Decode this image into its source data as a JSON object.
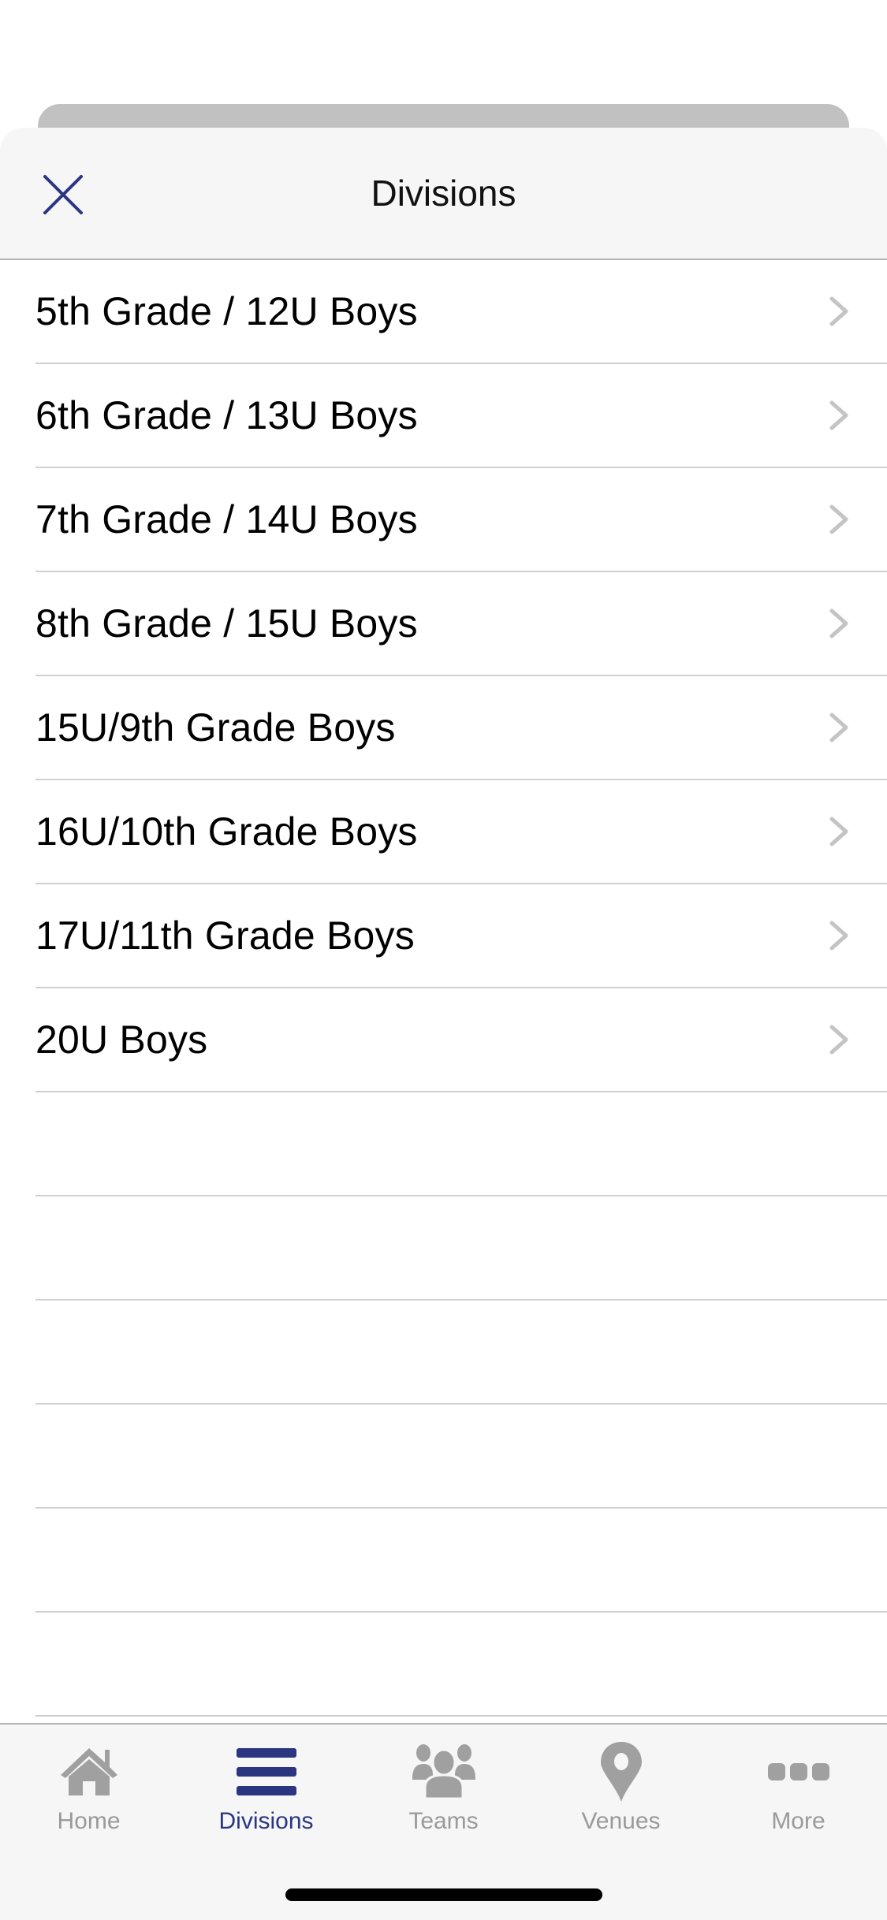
{
  "sheet": {
    "title": "Divisions",
    "close_icon": "close-icon"
  },
  "divisions": [
    {
      "label": "5th Grade / 12U Boys"
    },
    {
      "label": "6th Grade / 13U Boys"
    },
    {
      "label": "7th Grade / 14U Boys"
    },
    {
      "label": "8th Grade / 15U Boys"
    },
    {
      "label": "15U/9th Grade Boys"
    },
    {
      "label": "16U/10th Grade Boys"
    },
    {
      "label": "17U/11th Grade Boys"
    },
    {
      "label": "20U Boys"
    }
  ],
  "tabbar": {
    "active": "Divisions",
    "tabs": [
      {
        "label": "Home",
        "icon": "home-icon"
      },
      {
        "label": "Divisions",
        "icon": "menu-icon"
      },
      {
        "label": "Teams",
        "icon": "team-icon"
      },
      {
        "label": "Venues",
        "icon": "map-pin-icon"
      },
      {
        "label": "More",
        "icon": "more-icon"
      }
    ]
  },
  "colors": {
    "accent": "#2b3580",
    "inactive": "#a0a0a0",
    "chevron": "#c4c4c4"
  }
}
